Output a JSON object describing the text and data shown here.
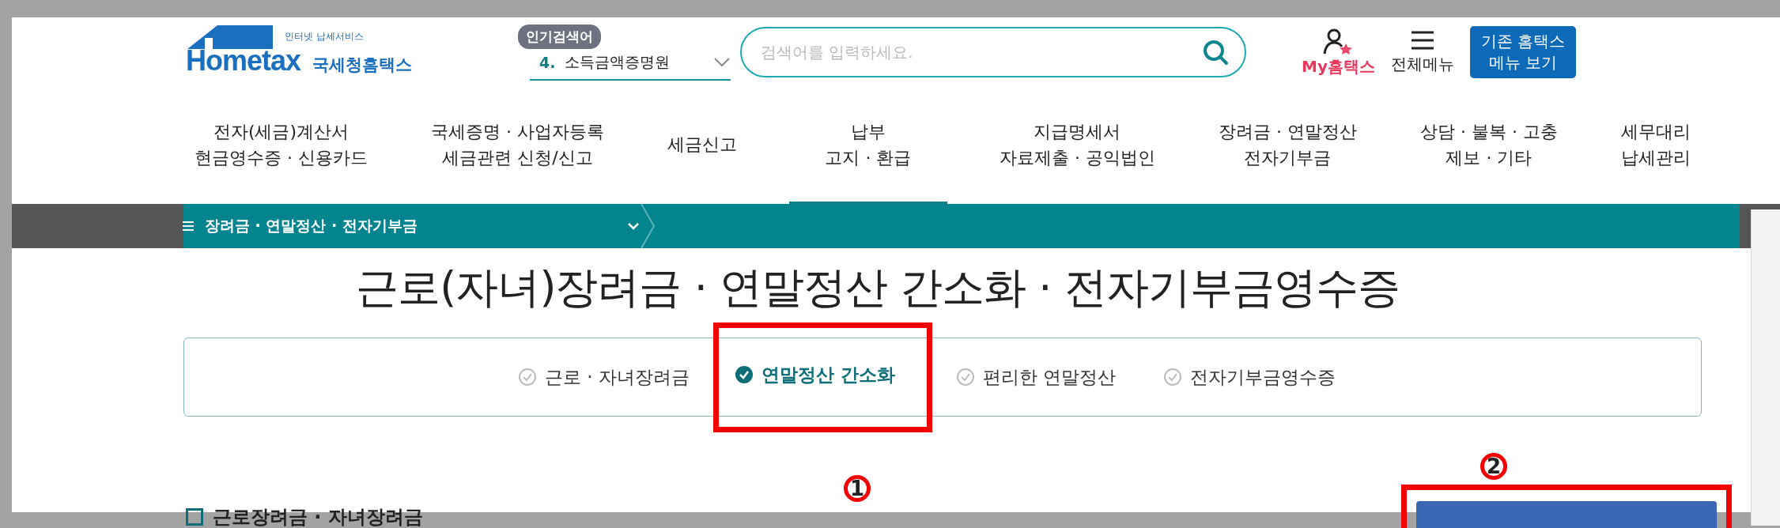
{
  "header": {
    "logo": {
      "tagline": "인터넷 납세서비스",
      "wordmark": "Hometax",
      "name": "국세청홈택스"
    },
    "popular_search": {
      "badge": "인기검색어",
      "rank": "4.",
      "term": "소득금액증명원"
    },
    "search": {
      "placeholder": "검색어를 입력하세요."
    },
    "my_hometax": "My홈택스",
    "all_menu": "전체메뉴",
    "legacy_button": [
      "기존 홈택스",
      "메뉴 보기"
    ]
  },
  "nav": [
    {
      "lines": [
        "전자(세금)계산서",
        "현금영수증 · 신용카드"
      ],
      "selected": false
    },
    {
      "lines": [
        "국세증명 · 사업자등록",
        "세금관련 신청/신고"
      ],
      "selected": false
    },
    {
      "lines": [
        "세금신고"
      ],
      "selected": false
    },
    {
      "lines": [
        "납부",
        "고지 · 환급"
      ],
      "selected": true
    },
    {
      "lines": [
        "지급명세서",
        "자료제출 · 공익법인"
      ],
      "selected": false
    },
    {
      "lines": [
        "장려금 · 연말정산",
        "전자기부금"
      ],
      "selected": false
    },
    {
      "lines": [
        "상담 · 불복 · 고충",
        "제보 · 기타"
      ],
      "selected": false
    },
    {
      "lines": [
        "세무대리",
        "납세관리"
      ],
      "selected": false
    }
  ],
  "breadcrumb": {
    "label": "장려금 · 연말정산 · 전자기부금"
  },
  "page_title": "근로(자녀)장려금 · 연말정산 간소화 · 전자기부금영수증",
  "tabs": [
    {
      "label": "근로 · 자녀장려금",
      "selected": false
    },
    {
      "label": "연말정산 간소화",
      "selected": true
    },
    {
      "label": "편리한 연말정산",
      "selected": false
    },
    {
      "label": "전자기부금영수증",
      "selected": false
    }
  ],
  "section_heading": "근로장려금 · 자녀장려금",
  "callouts": [
    "1",
    "2"
  ]
}
